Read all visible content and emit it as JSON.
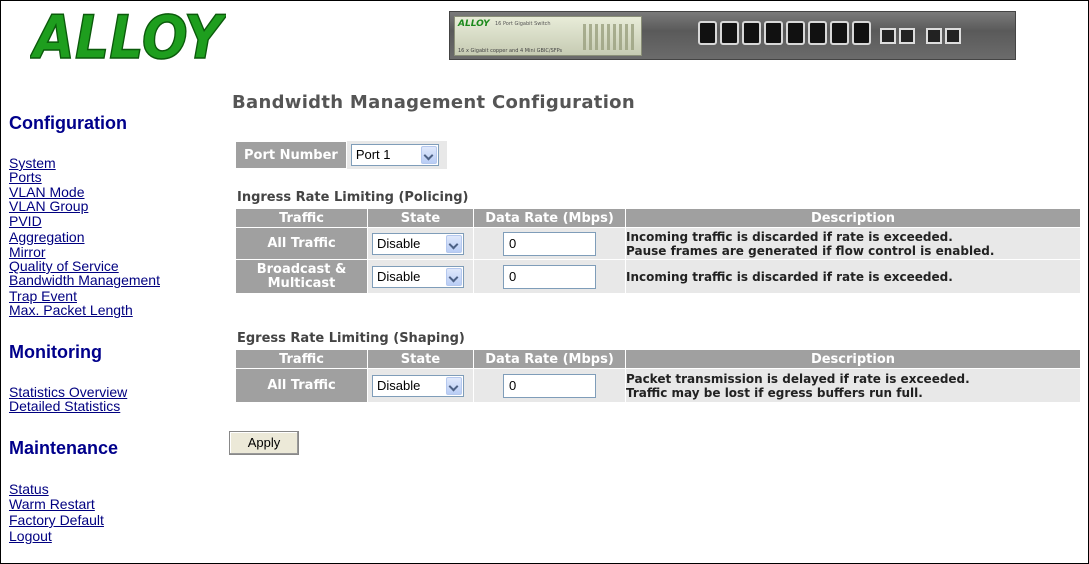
{
  "header": {
    "logo_text": "ALLOY",
    "switch_image": {
      "brand": "ALLOY",
      "model": "16 Port Gigabit Switch",
      "subtitle": "16 x Gigabit copper and 4 Mini GBIC/SFPs"
    }
  },
  "sidebar": {
    "configuration_heading": "Configuration",
    "configuration_items": [
      "System",
      "Ports",
      "VLAN Mode",
      "VLAN Group",
      "PVID",
      "Aggregation",
      "Mirror",
      "Quality of Service",
      "Bandwidth Management",
      "Trap Event",
      "Max. Packet Length"
    ],
    "monitoring_heading": "Monitoring",
    "monitoring_items": [
      "Statistics Overview",
      "Detailed Statistics"
    ],
    "maintenance_heading": "Maintenance",
    "maintenance_items": [
      "Status",
      "Warm Restart",
      "Factory Default",
      "Logout"
    ]
  },
  "main": {
    "title": "Bandwidth Management Configuration",
    "port_number_label": "Port Number",
    "port_number_value": "Port 1",
    "ingress": {
      "title": "Ingress Rate Limiting (Policing)",
      "headers": [
        "Traffic",
        "State",
        "Data Rate (Mbps)",
        "Description"
      ],
      "rows": [
        {
          "traffic": "All Traffic",
          "state": "Disable",
          "rate": "0",
          "desc1": "Incoming traffic is discarded if rate is exceeded.",
          "desc2": "Pause frames are generated if flow control is enabled."
        },
        {
          "traffic1": "Broadcast &",
          "traffic2": "Multicast",
          "state": "Disable",
          "rate": "0",
          "desc1": "Incoming traffic is discarded if rate is exceeded."
        }
      ]
    },
    "egress": {
      "title": "Egress Rate Limiting (Shaping)",
      "headers": [
        "Traffic",
        "State",
        "Data Rate (Mbps)",
        "Description"
      ],
      "rows": [
        {
          "traffic": "All Traffic",
          "state": "Disable",
          "rate": "0",
          "desc1": "Packet transmission is delayed if rate is exceeded.",
          "desc2": "Traffic may be lost if egress buffers run full."
        }
      ]
    },
    "apply_label": "Apply"
  },
  "colors": {
    "header_cell": "#a0a0a0",
    "cell_bg": "#e8e8e8",
    "nav_heading": "#00008b",
    "nav_link": "#000080",
    "logo_green": "#1e9e1e"
  }
}
